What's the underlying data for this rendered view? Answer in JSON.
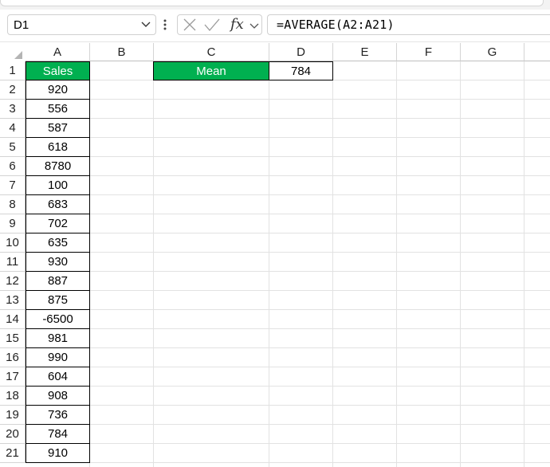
{
  "name_box": {
    "value": "D1"
  },
  "formula_bar": {
    "value": "=AVERAGE(A2:A21)",
    "fx_label": "fx"
  },
  "columns": [
    "A",
    "B",
    "C",
    "D",
    "E",
    "F",
    "G"
  ],
  "rows": [
    "1",
    "2",
    "3",
    "4",
    "5",
    "6",
    "7",
    "8",
    "9",
    "10",
    "11",
    "12",
    "13",
    "14",
    "15",
    "16",
    "17",
    "18",
    "19",
    "20",
    "21"
  ],
  "cells": {
    "A1": "Sales",
    "C1": "Mean",
    "D1": "784",
    "A2": "920",
    "A3": "556",
    "A4": "587",
    "A5": "618",
    "A6": "8780",
    "A7": "100",
    "A8": "683",
    "A9": "702",
    "A10": "635",
    "A11": "930",
    "A12": "887",
    "A13": "875",
    "A14": "-6500",
    "A15": "981",
    "A16": "990",
    "A17": "604",
    "A18": "908",
    "A19": "736",
    "A20": "784",
    "A21": "910"
  },
  "colors": {
    "header_fill": "#00b050",
    "header_text": "#ffffff"
  }
}
